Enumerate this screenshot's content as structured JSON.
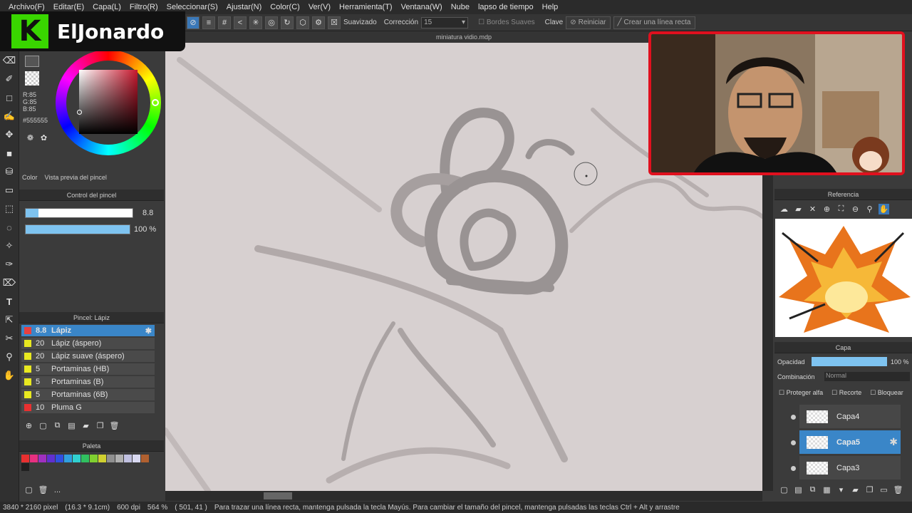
{
  "menu": [
    "Archivo(F)",
    "Editar(E)",
    "Capa(L)",
    "Filtro(R)",
    "Seleccionar(S)",
    "Ajustar(N)",
    "Color(C)",
    "Ver(V)",
    "Herramienta(T)",
    "Ventana(W)",
    "Nube",
    "lapso de tiempo",
    "Help"
  ],
  "toolbar": {
    "smoothing_label": "Suavizado",
    "correction_label": "Corrección",
    "correction_value": "15",
    "soft_edges_label": "Bordes Suaves",
    "key_label": "Clave",
    "reset_label": "Reiniciar",
    "line_label": "Crear una línea recta"
  },
  "overlay": {
    "logo_letter": "K",
    "channel_name": "ElJonardo"
  },
  "document": {
    "title": "miniatura vidio.mdp"
  },
  "color": {
    "r": "R:85",
    "g": "G:85",
    "b": "B:85",
    "hex": "#555555",
    "tab_color": "Color",
    "tab_preview": "Vista previa del pincel"
  },
  "brush_control": {
    "title": "Control del pincel",
    "size": "8.8",
    "opacity": "100 %",
    "size_fill": 0.12,
    "opacity_fill": 1.0
  },
  "brush_list": {
    "title": "Pincel: Lápiz",
    "items": [
      {
        "size": "8.8",
        "name": "Lápiz",
        "color": "#e84040"
      },
      {
        "size": "20",
        "name": "Lápiz (áspero)",
        "color": "#e8e820"
      },
      {
        "size": "20",
        "name": "Lápiz suave (áspero)",
        "color": "#e8e820"
      },
      {
        "size": "5",
        "name": "Portaminas (HB)",
        "color": "#e8e820"
      },
      {
        "size": "5",
        "name": "Portaminas (B)",
        "color": "#e8e820"
      },
      {
        "size": "5",
        "name": "Portaminas (6B)",
        "color": "#e8e820"
      },
      {
        "size": "10",
        "name": "Pluma G",
        "color": "#e83030"
      }
    ]
  },
  "palette": {
    "title": "Paleta",
    "colors": [
      "#e83030",
      "#e83080",
      "#a030c0",
      "#6030d0",
      "#3050e0",
      "#30a0e0",
      "#30d0d0",
      "#30c060",
      "#80d030",
      "#d0d030",
      "#909090",
      "#b0b0b0",
      "#c0c0e0",
      "#d8d8f0",
      "#b06030",
      "#202020"
    ],
    "more": "..."
  },
  "reference": {
    "title": "Referencia"
  },
  "layers": {
    "title": "Capa",
    "opacity_label": "Opacidad",
    "opacity_value": "100 %",
    "opacity_fill": 1.0,
    "blend_label": "Combinación",
    "blend_value": "Normal",
    "protect_alpha": "Proteger alfa",
    "clip": "Recorte",
    "lock": "Bloquear",
    "items": [
      {
        "name": "Capa4",
        "selected": false
      },
      {
        "name": "Capa5",
        "selected": true
      },
      {
        "name": "Capa3",
        "selected": false
      }
    ]
  },
  "status": {
    "size": "3840 * 2160 pixel",
    "cm": "(16.3 * 9.1cm)",
    "dpi": "600 dpi",
    "zoom": "564 %",
    "coords": "( 501, 41 )",
    "hint": "Para trazar una línea recta, mantenga pulsada la tecla Mayús. Para cambiar el tamaño del pincel, mantenga pulsadas las teclas Ctrl + Alt y arrastre"
  }
}
